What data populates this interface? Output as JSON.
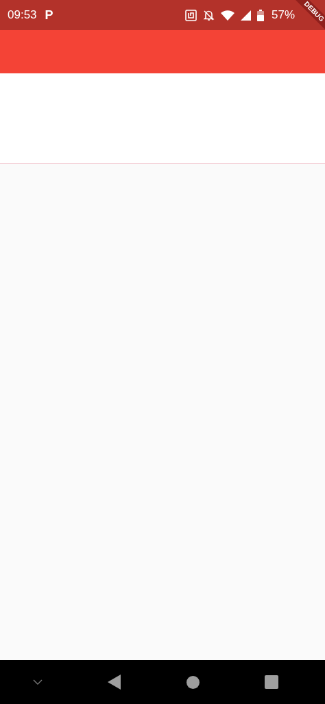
{
  "status_bar": {
    "time": "09:53",
    "notification": "P",
    "battery": "57%"
  },
  "debug_banner": {
    "label": "DEBUG"
  }
}
